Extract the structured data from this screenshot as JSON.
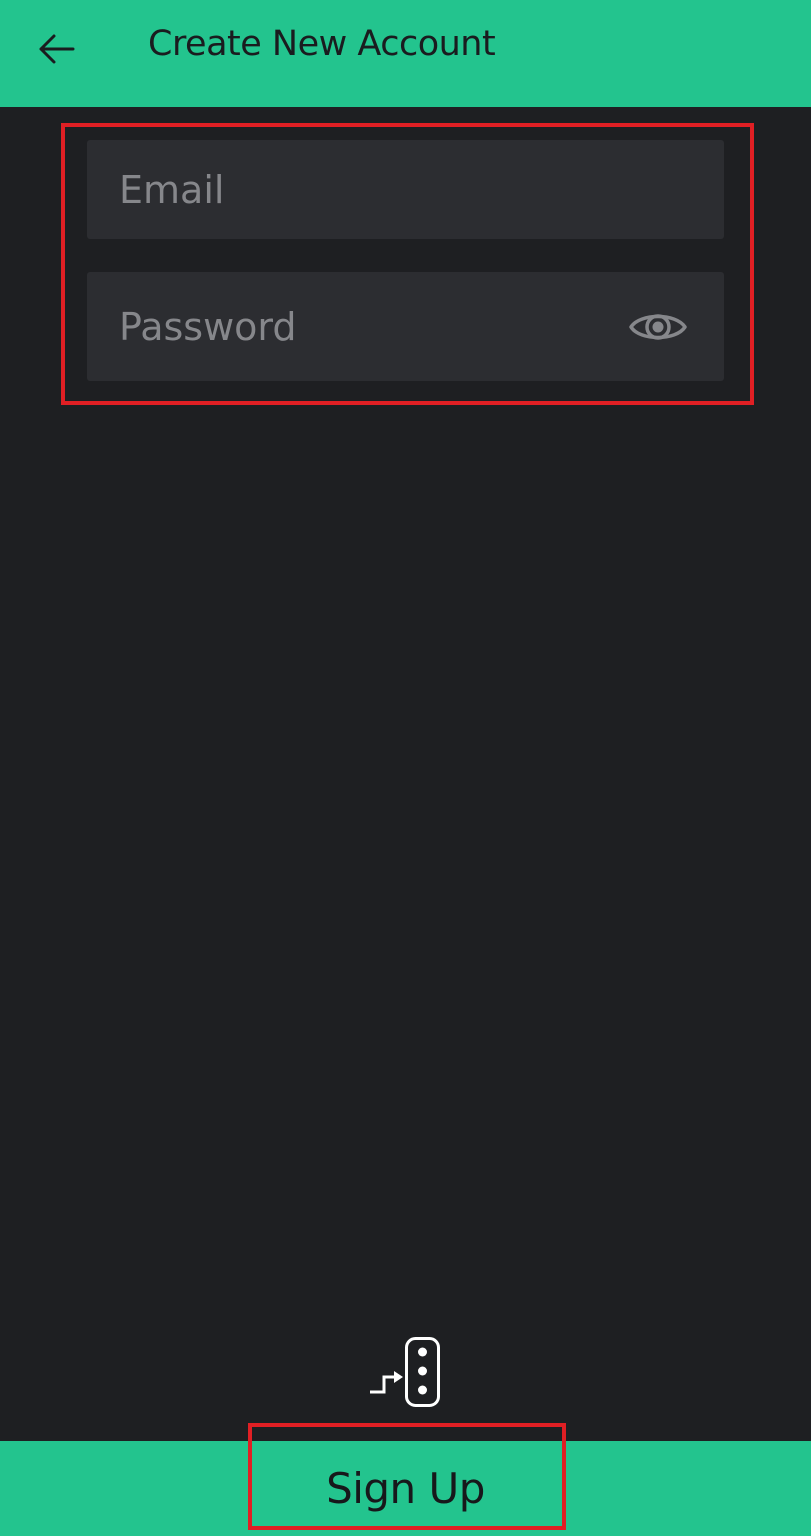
{
  "header": {
    "title": "Create New Account",
    "back_icon": "arrow-left-icon"
  },
  "form": {
    "email_placeholder": "Email",
    "email_value": "",
    "password_placeholder": "Password",
    "password_value": "",
    "visibility_icon": "eye-icon"
  },
  "footer": {
    "signup_label": "Sign Up"
  },
  "colors": {
    "accent": "#23c48e",
    "background": "#1e1f22",
    "field_background": "#2c2d31",
    "highlight": "#e01f24"
  }
}
